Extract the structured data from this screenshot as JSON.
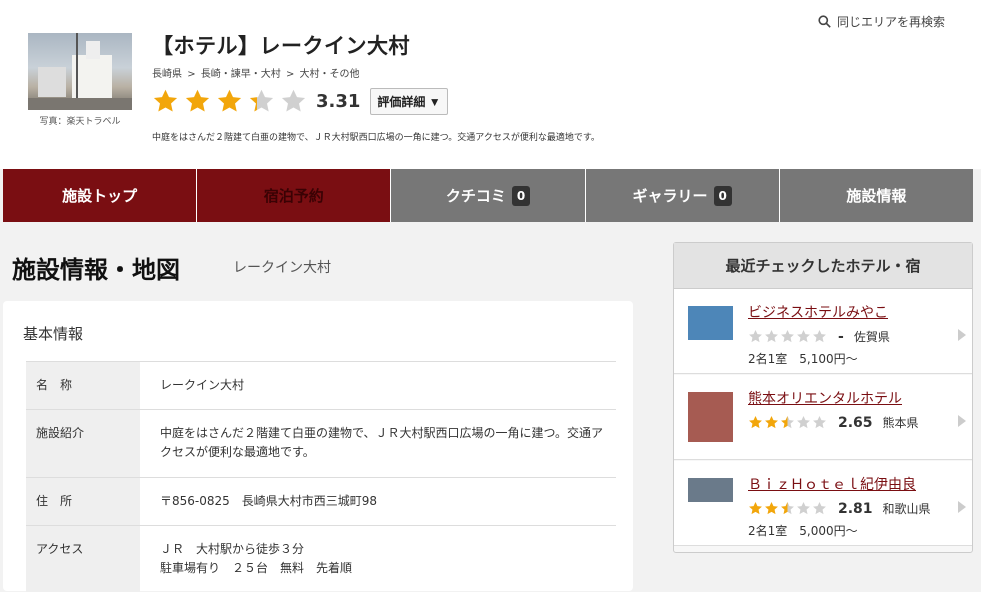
{
  "header": {
    "search_label": "同じエリアを再検索",
    "photo_credit": "写真：楽天トラベル",
    "title": "【ホテル】レークイン大村",
    "breadcrumb": [
      "長崎県",
      ">",
      "長崎・諫早・大村",
      ">",
      "大村・その他"
    ],
    "rating_value": "3.31",
    "rating_fraction": 0.662,
    "detail_button": "評価詳細 ▼",
    "description": "中庭をはさんだ２階建て白亜の建物で、ＪＲ大村駅西口広場の一角に建つ。交通アクセスが便利な最適地です。"
  },
  "tabs": [
    {
      "label": "施設トップ",
      "count": null,
      "style": "dark"
    },
    {
      "label": "宿泊予約",
      "count": null,
      "style": "dark reserve"
    },
    {
      "label": "クチコミ",
      "count": "0",
      "style": ""
    },
    {
      "label": "ギャラリー",
      "count": "0",
      "style": ""
    },
    {
      "label": "施設情報",
      "count": null,
      "style": ""
    }
  ],
  "main": {
    "title": "施設情報・地図",
    "subtitle": "レークイン大村",
    "card_heading": "基本情報",
    "rows": [
      {
        "key": "名　称",
        "value": "レークイン大村"
      },
      {
        "key": "施設紹介",
        "value": "中庭をはさんだ２階建て白亜の建物で、ＪＲ大村駅西口広場の一角に建つ。交通アクセスが便利な最適地です。"
      },
      {
        "key": "住　所",
        "value": "〒856-0825　長崎県大村市西三城町98"
      },
      {
        "key": "アクセス",
        "value": "ＪＲ　大村駅から徒歩３分\n駐車場有り　２５台　無料　先着順"
      }
    ]
  },
  "sidebar": {
    "heading": "最近チェックしたホテル・宿",
    "hotels": [
      {
        "name": "ビジネスホテルみやこ",
        "stars": 0,
        "score": "-",
        "pref": "佐賀県",
        "price": "2名1室　5,100円〜",
        "thumb_color": "#4d86b8"
      },
      {
        "name": "熊本オリエンタルホテル",
        "stars": 2.5,
        "score": "2.65",
        "pref": "熊本県",
        "price": "",
        "thumb_color": "#a65b52"
      },
      {
        "name": "ＢｉｚＨｏｔｅｌ紀伊由良",
        "stars": 2.5,
        "score": "2.81",
        "pref": "和歌山県",
        "price": "2名1室　5,000円〜",
        "thumb_color": "#6a7a8a"
      }
    ]
  },
  "colors": {
    "accent": "#7a0e12",
    "star": "#f2a60b",
    "star_empty": "#d0d0d0",
    "tab_gray": "#777777"
  }
}
